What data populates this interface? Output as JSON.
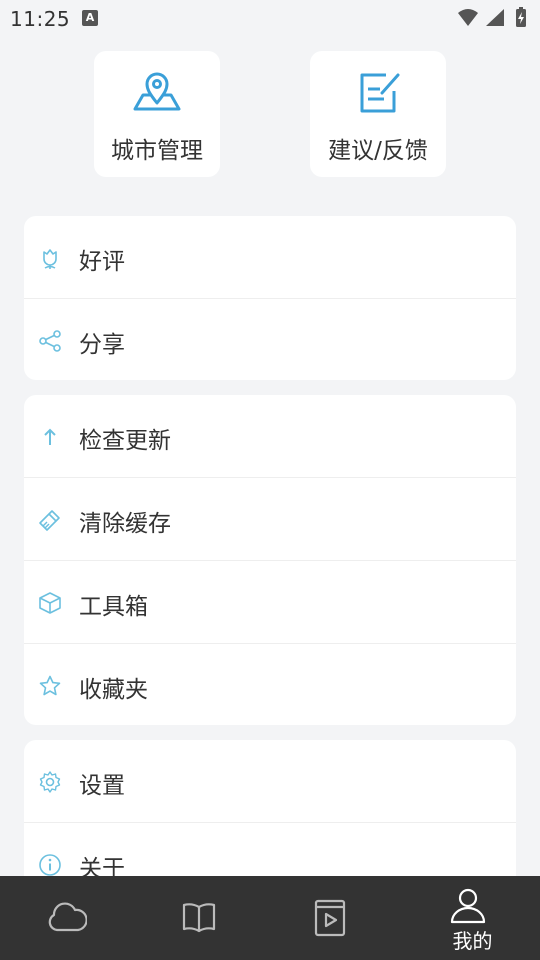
{
  "status_bar": {
    "time": "11:25",
    "notification_glyph": "A",
    "icons": [
      "wifi-icon",
      "signal-icon",
      "battery-charging-icon"
    ]
  },
  "quick_actions": [
    {
      "label": "城市管理",
      "icon": "location-map-icon"
    },
    {
      "label": "建议/反馈",
      "icon": "edit-note-icon"
    }
  ],
  "menu_groups": [
    [
      {
        "label": "好评",
        "icon": "flower-icon"
      },
      {
        "label": "分享",
        "icon": "share-icon"
      }
    ],
    [
      {
        "label": "检查更新",
        "icon": "arrow-up-icon"
      },
      {
        "label": "清除缓存",
        "icon": "brush-icon"
      },
      {
        "label": "工具箱",
        "icon": "box-icon"
      },
      {
        "label": "收藏夹",
        "icon": "star-icon"
      }
    ],
    [
      {
        "label": "设置",
        "icon": "gear-icon"
      },
      {
        "label": "关于",
        "icon": "info-icon"
      }
    ]
  ],
  "bottom_nav": {
    "items": [
      {
        "label": "",
        "icon": "cloud-icon"
      },
      {
        "label": "",
        "icon": "book-icon"
      },
      {
        "label": "",
        "icon": "video-icon"
      },
      {
        "label": "我的",
        "icon": "user-icon"
      }
    ],
    "active_index": 3
  },
  "colors": {
    "accent": "#3a9fd8",
    "menu_icon": "#6cc0df",
    "background": "#f3f4f6",
    "nav_background": "#333333"
  }
}
